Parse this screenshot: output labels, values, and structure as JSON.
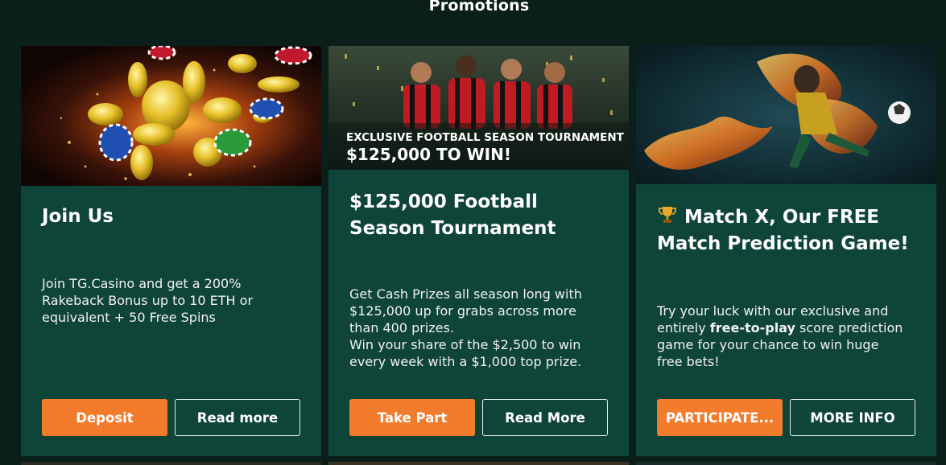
{
  "page": {
    "title": "Promotions"
  },
  "cards": [
    {
      "title": "Join Us",
      "description": "Join TG.Casino and get a 200% Rakeback Bonus up to 10 ETH or equivalent + 50 Free Spins",
      "primary_button": "Deposit",
      "secondary_button": "Read more"
    },
    {
      "banner_line1": "EXCLUSIVE FOOTBALL SEASON TOURNAMENT",
      "banner_line2": "$125,000 TO WIN!",
      "title_line1": "$125,000 Football",
      "title_line2": "Season Tournament",
      "description_line1": "Get Cash Prizes all season long with $125,000 up for grabs across more than 400 prizes.",
      "description_line2": "Win your share of the $2,500 to win every week with a $1,000 top prize.",
      "primary_button": "Take Part",
      "secondary_button": "Read More"
    },
    {
      "title_icon": "trophy-icon",
      "title": "Match X, Our FREE Match Prediction Game!",
      "description_before": "Try your luck with our exclusive and entirely ",
      "description_bold": "free-to-play",
      "description_after": " score prediction game for your chance to win huge free bets!",
      "primary_button": "PARTICIPATE...",
      "secondary_button": "MORE INFO"
    }
  ],
  "colors": {
    "background": "#0b1f1a",
    "card": "#0f4438",
    "accent_orange": "#f27b2c"
  }
}
